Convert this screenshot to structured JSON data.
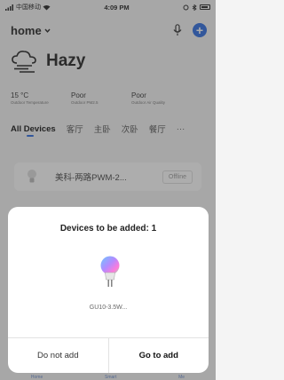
{
  "status_bar": {
    "carrier": "中国移动",
    "time": "4:09 PM"
  },
  "header": {
    "title": "home"
  },
  "weather": {
    "condition": "Hazy",
    "temperature": "15 °C",
    "temperature_label": "Outdoor Temperature",
    "pm25": "Poor",
    "pm25_label": "Outdoor PM2.5",
    "air_quality": "Poor",
    "air_quality_label": "Outdoor Air Quality"
  },
  "tabs": [
    {
      "label": "All Devices"
    },
    {
      "label": "客厅"
    },
    {
      "label": "主卧"
    },
    {
      "label": "次卧"
    },
    {
      "label": "餐厅"
    },
    {
      "label": "···"
    }
  ],
  "device": {
    "name": "美科-两路PWM-2...",
    "status": "Offline"
  },
  "dialog": {
    "title": "Devices to be added: 1",
    "device_name": "GU10-3.5W...",
    "cancel_label": "Do not add",
    "confirm_label": "Go to add"
  },
  "bottom_nav": [
    {
      "label": "Home"
    },
    {
      "label": "Smart"
    },
    {
      "label": "Me"
    }
  ],
  "colors": {
    "accent": "#2c6be0"
  }
}
